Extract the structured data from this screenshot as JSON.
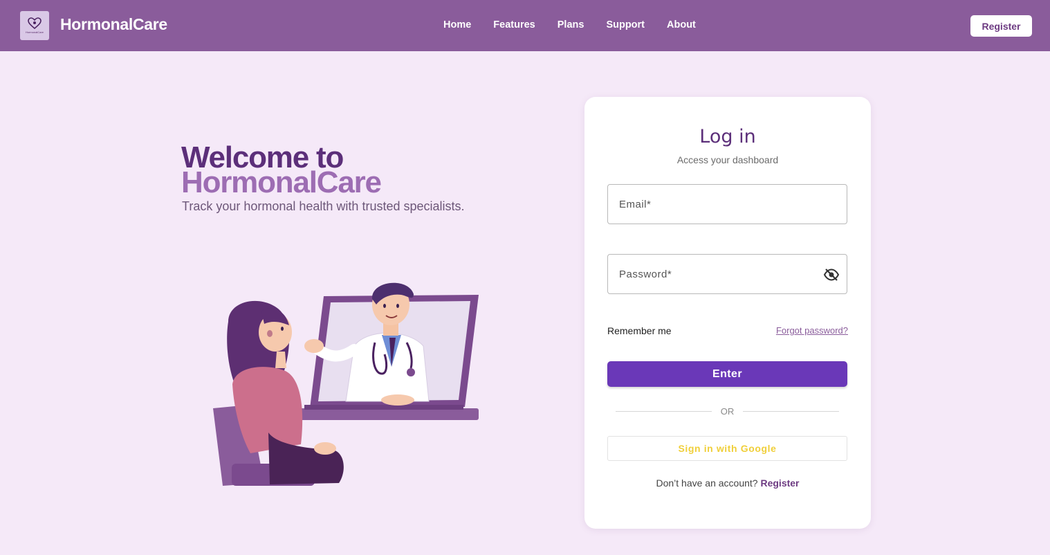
{
  "header": {
    "brand": "HormonalCare",
    "logo_caption": "HormonalCare",
    "nav": [
      "Home",
      "Features",
      "Plans",
      "Support",
      "About"
    ],
    "register_label": "Register"
  },
  "hero": {
    "title_line1": "Welcome to",
    "title_line2": "HormonalCare",
    "subtitle": "Track your hormonal health with trusted specialists."
  },
  "login": {
    "title": "Log in",
    "subtitle": "Access your dashboard",
    "email_placeholder": "Email*",
    "password_placeholder": "Password*",
    "remember_label": "Remember me",
    "forgot_label": "Forgot password?",
    "enter_label": "Enter",
    "or_label": "OR",
    "google_label": "Sign in with Google",
    "no_account_text": "Don’t have an account?",
    "register_link": "Register"
  },
  "icons": {
    "logo": "heart-stethoscope-icon",
    "password_toggle": "eye-off-icon"
  },
  "colors": {
    "header_bg": "#8a5c9b",
    "page_bg": "#f5e9f8",
    "primary": "#6a38b8",
    "title_dark": "#5c2f7a",
    "title_light": "#9d6db3",
    "google_text": "#f0cf3a"
  }
}
